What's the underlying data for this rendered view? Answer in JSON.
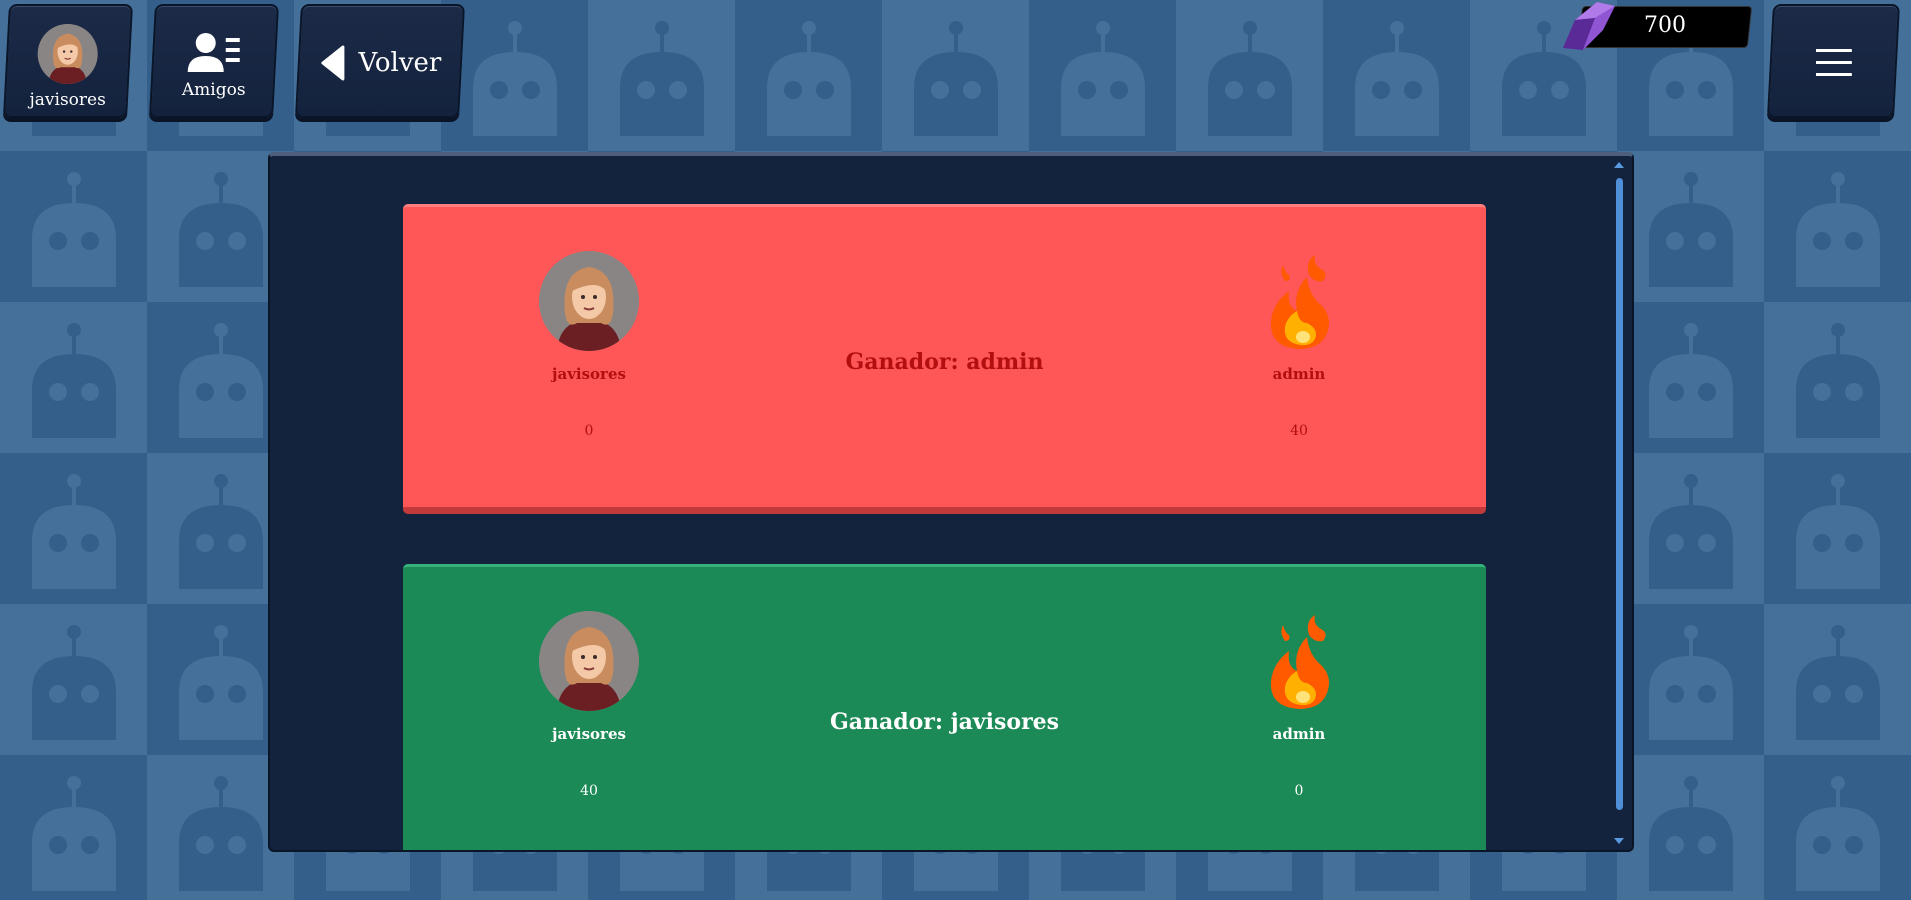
{
  "header": {
    "profile": {
      "username": "javisores"
    },
    "friends": {
      "label": "Amigos"
    },
    "back": {
      "label": "Volver"
    },
    "currency": {
      "value": "700",
      "icon": "gem-icon"
    },
    "menu": {
      "icon": "hamburger-menu-icon"
    }
  },
  "matches": [
    {
      "result": "loss",
      "winner_text": "Ganador: admin",
      "player_left": {
        "name": "javisores",
        "score": "0",
        "avatar": "avatar-icon"
      },
      "player_right": {
        "name": "admin",
        "score": "40",
        "avatar": "flame-icon"
      }
    },
    {
      "result": "win",
      "winner_text": "Ganador: javisores",
      "player_left": {
        "name": "javisores",
        "score": "40",
        "avatar": "avatar-icon"
      },
      "player_right": {
        "name": "admin",
        "score": "0",
        "avatar": "flame-icon"
      }
    }
  ],
  "colors": {
    "loss_card": "#ff5657",
    "win_card": "#1b8a56",
    "panel": "#13223d",
    "scrollbar": "#4f8fd8"
  }
}
